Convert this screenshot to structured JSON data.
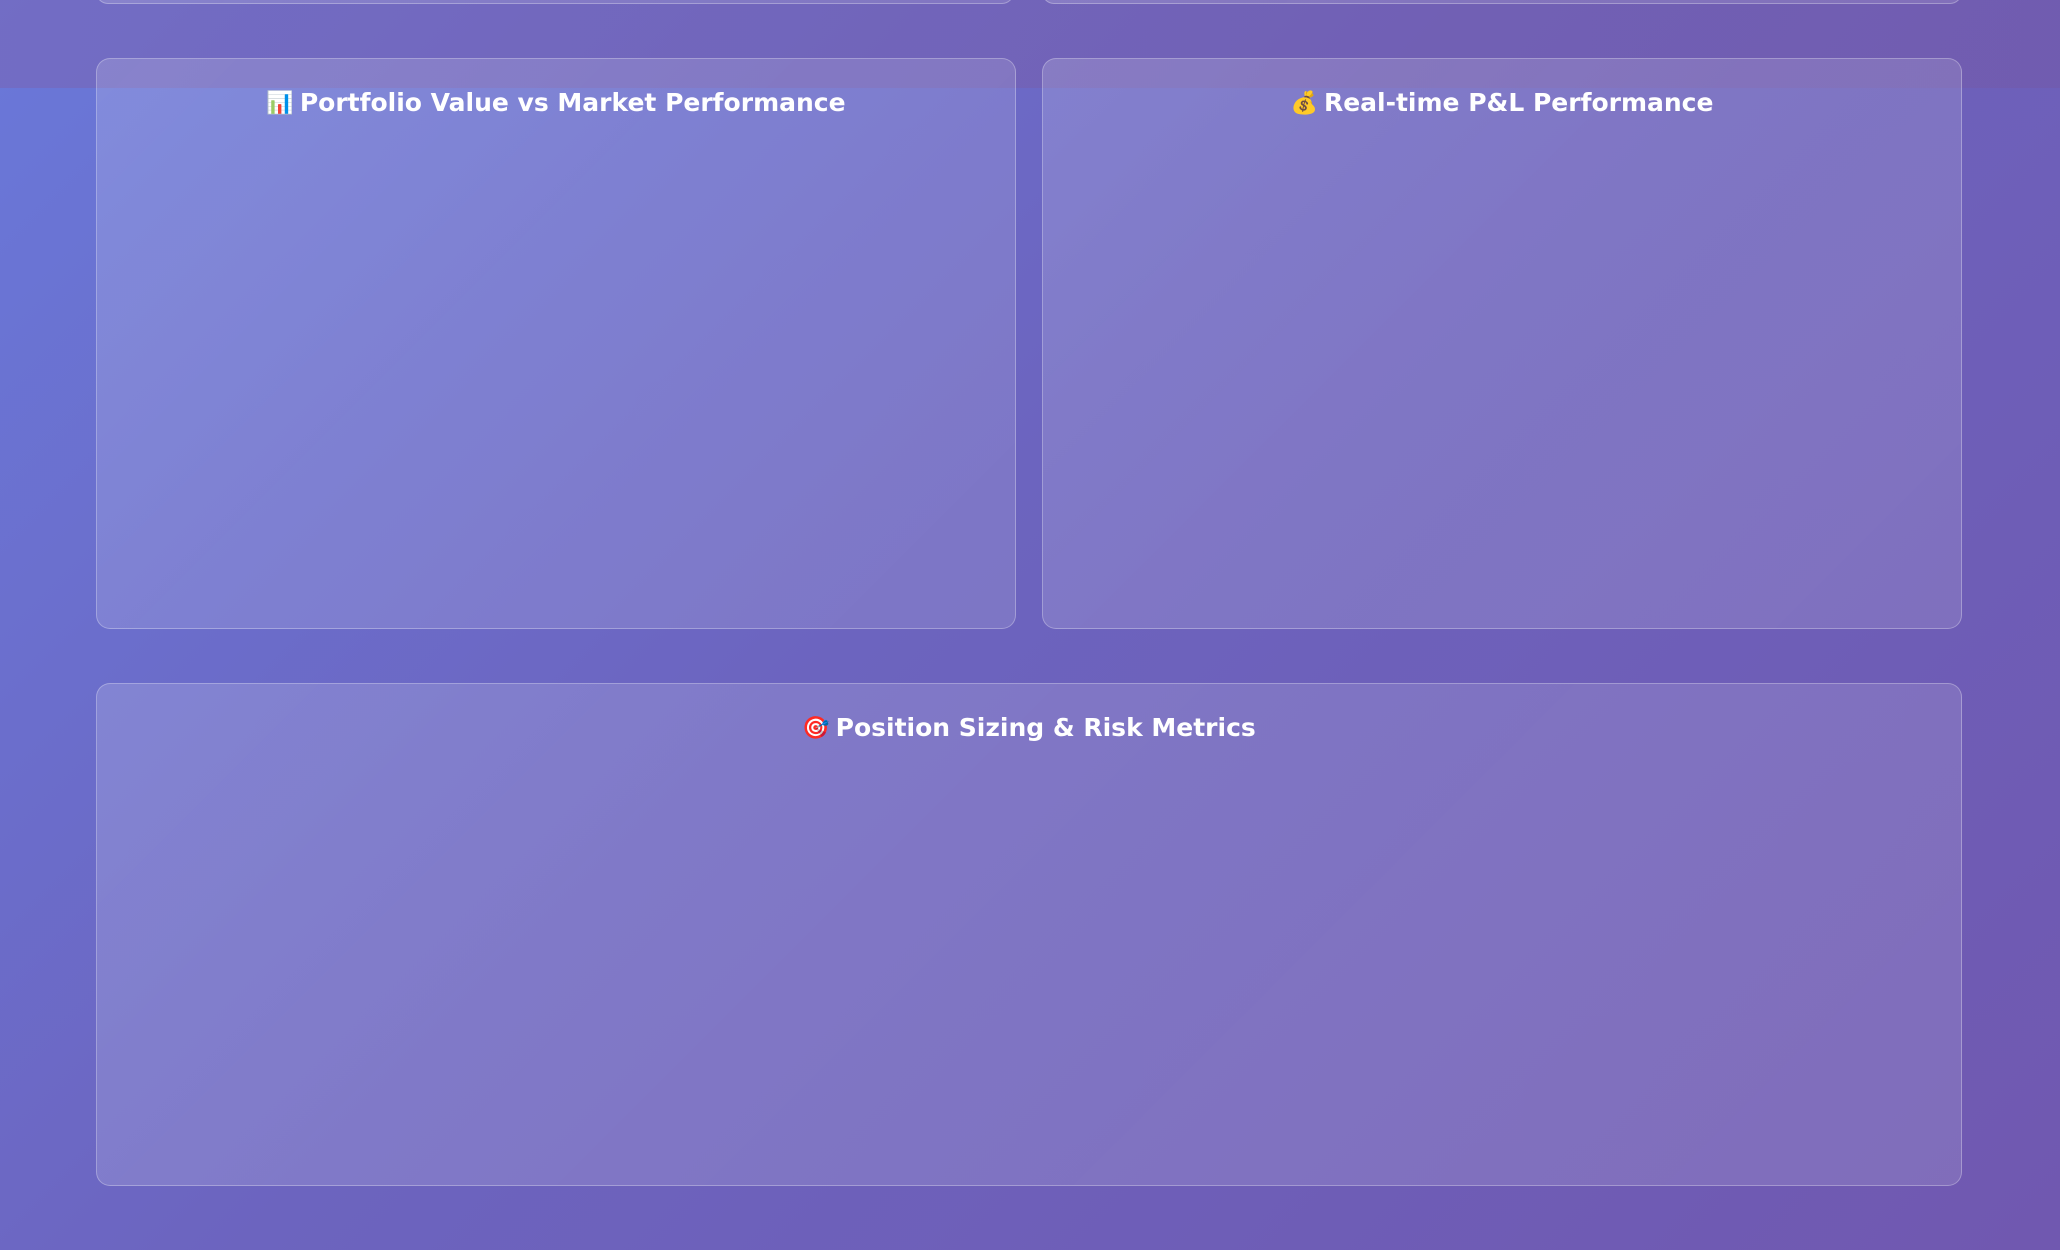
{
  "panels": {
    "portfolio": {
      "title": "Portfolio Value vs Market Performance",
      "icon": "📊",
      "icon_name": "bar-chart-icon"
    },
    "pnl": {
      "title": "Real-time P&L Performance",
      "icon": "💰",
      "icon_name": "money-bag-icon"
    },
    "position": {
      "title": "Position Sizing & Risk Metrics",
      "icon": "🎯",
      "icon_name": "target-icon"
    }
  },
  "colors": {
    "background_start": "#6a78d9",
    "background_end": "#7058b0",
    "title_text": "#ffffff"
  }
}
